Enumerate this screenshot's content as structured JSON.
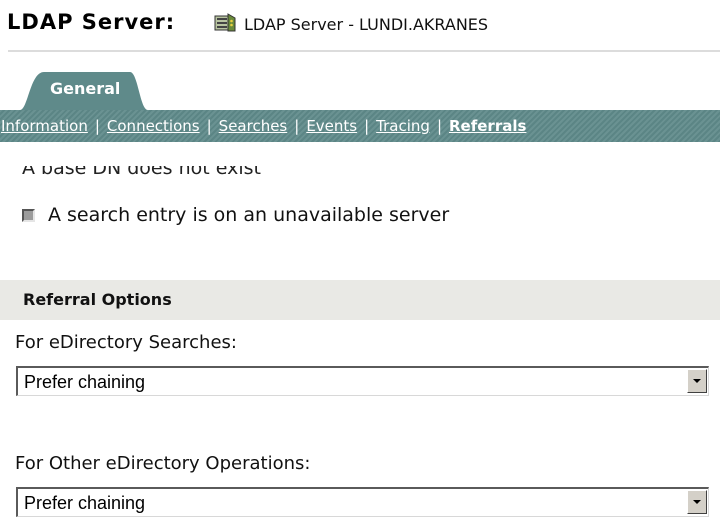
{
  "header": {
    "title": "LDAP Server:",
    "server_icon": "server-object-icon",
    "server_name": "LDAP Server - LUNDI.AKRANES"
  },
  "tabs": [
    {
      "label": "General",
      "active": true
    }
  ],
  "subnav": {
    "items": [
      "Information",
      "Connections",
      "Searches",
      "Events",
      "Tracing",
      "Referrals"
    ],
    "active": "Referrals",
    "separator": "|"
  },
  "content": {
    "partial_row_text": "A base DN does not exist",
    "checkbox_search_entry_label": "A search entry is on an unavailable server",
    "referral_options": {
      "section_title": "Referral Options",
      "edirectory_searches": {
        "label": "For eDirectory Searches:",
        "selected": "Prefer chaining"
      },
      "other_operations": {
        "label": "For Other eDirectory Operations:",
        "selected": "Prefer chaining"
      }
    }
  },
  "colors": {
    "tab_teal": "#5f8a8a",
    "section_bg": "#e9e9e5"
  }
}
